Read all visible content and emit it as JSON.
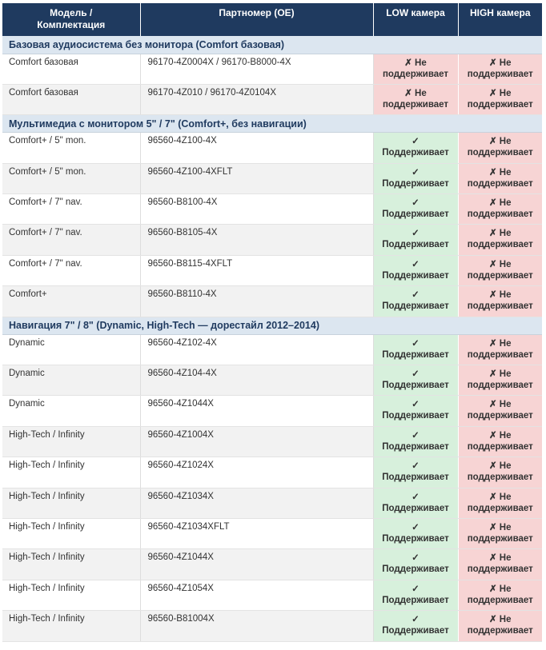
{
  "header": {
    "model_line1": "Модель /",
    "model_line2": "Комплектация",
    "part": "Партномер (OE)",
    "low": "LOW камера",
    "high": "HIGH камера"
  },
  "status": {
    "yes_mark": "✓",
    "yes_text": "Поддерживает",
    "no_mark": "✗ Не",
    "no_text": "поддерживает",
    "yes_color": "#1e7a33",
    "no_color": "#b52b2b"
  },
  "sections": [
    {
      "title": "Базовая аудиосистема без монитора (Comfort базовая)",
      "rows": [
        {
          "model": "Comfort базовая",
          "part": "96170-4Z0004X / 96170-B8000-4X",
          "low": false,
          "high": false
        },
        {
          "model": "Comfort базовая",
          "part": "96170-4Z010 / 96170-4Z0104X",
          "low": false,
          "high": false
        }
      ]
    },
    {
      "title": "Мультимедиа с монитором 5\" / 7\" (Comfort+, без навигации)",
      "rows": [
        {
          "model": "Comfort+ / 5\" mon.",
          "part": "96560-4Z100-4X",
          "low": true,
          "high": false
        },
        {
          "model": "Comfort+ / 5\" mon.",
          "part": "96560-4Z100-4XFLT",
          "low": true,
          "high": false
        },
        {
          "model": "Comfort+ / 7\" nav.",
          "part": "96560-B8100-4X",
          "low": true,
          "high": false
        },
        {
          "model": "Comfort+ / 7\" nav.",
          "part": "96560-B8105-4X",
          "low": true,
          "high": false
        },
        {
          "model": "Comfort+ / 7\" nav.",
          "part": "96560-B8115-4XFLT",
          "low": true,
          "high": false
        },
        {
          "model": "Comfort+",
          "part": "96560-B8110-4X",
          "low": true,
          "high": false
        }
      ]
    },
    {
      "title": "Навигация 7\" / 8\" (Dynamic, High-Tech — дорестайл 2012–2014)",
      "rows": [
        {
          "model": "Dynamic",
          "part": "96560-4Z102-4X",
          "low": true,
          "high": false
        },
        {
          "model": "Dynamic",
          "part": "96560-4Z104-4X",
          "low": true,
          "high": false
        },
        {
          "model": "Dynamic",
          "part": "96560-4Z1044X",
          "low": true,
          "high": false
        },
        {
          "model": "High-Tech / Infinity",
          "part": "96560-4Z1004X",
          "low": true,
          "high": false
        },
        {
          "model": "High-Tech / Infinity",
          "part": "96560-4Z1024X",
          "low": true,
          "high": false
        },
        {
          "model": "High-Tech / Infinity",
          "part": "96560-4Z1034X",
          "low": true,
          "high": false
        },
        {
          "model": "High-Tech / Infinity",
          "part": "96560-4Z1034XFLT",
          "low": true,
          "high": false
        },
        {
          "model": "High-Tech / Infinity",
          "part": "96560-4Z1044X",
          "low": true,
          "high": false
        },
        {
          "model": "High-Tech / Infinity",
          "part": "96560-4Z1054X",
          "low": true,
          "high": false
        },
        {
          "model": "High-Tech / Infinity",
          "part": "96560-B81004X",
          "low": true,
          "high": false
        }
      ]
    }
  ]
}
